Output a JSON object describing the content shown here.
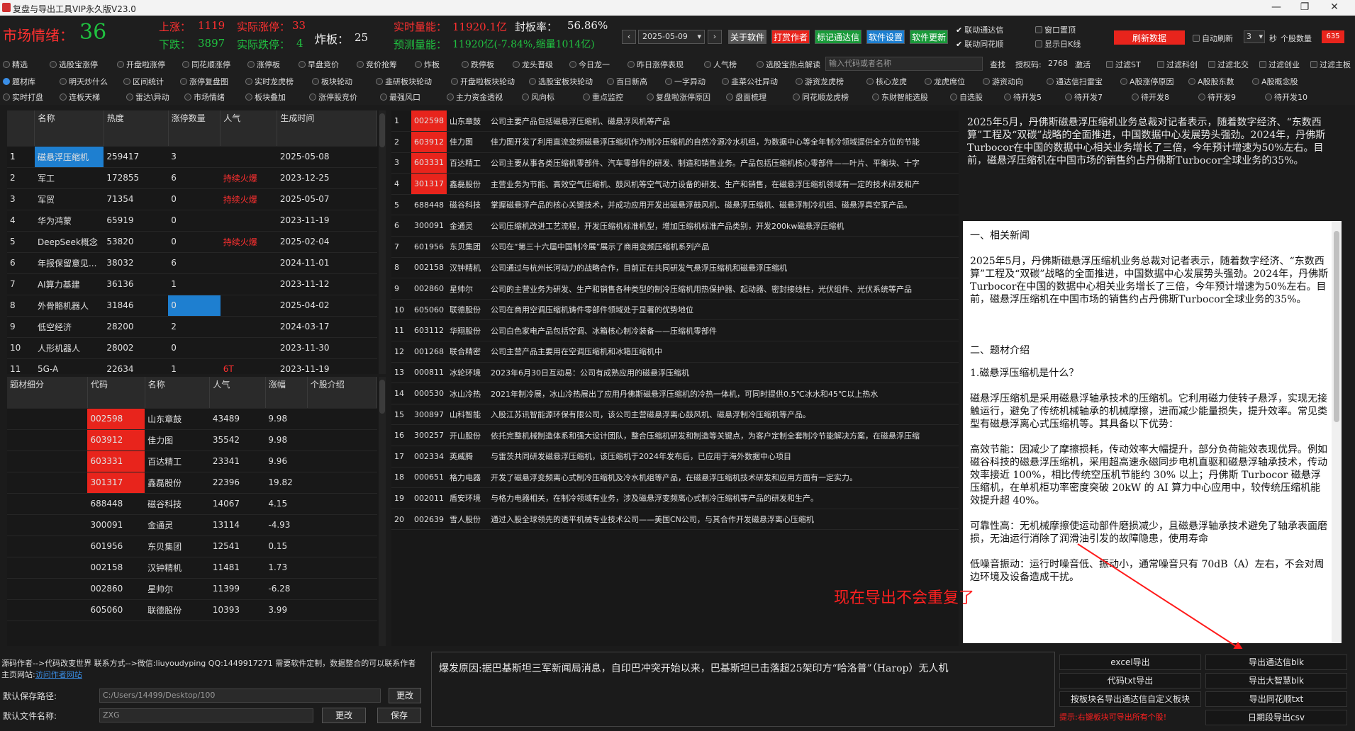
{
  "window": {
    "title": "复盘与导出工具VIP永久版V23.0",
    "min": "—",
    "max": "❐",
    "close": "✕"
  },
  "header": {
    "mood_label": "市场情绪：",
    "mood_value": "36",
    "up_label": "上涨：",
    "up_value": "1119",
    "limit_up_label": "实际涨停：",
    "limit_up_value": "33",
    "down_label": "下跌：",
    "down_value": "3897",
    "limit_down_label": "实际跌停：",
    "limit_down_value": "4",
    "break_label": "炸板：",
    "break_value": "25",
    "volume_label": "实时量能：",
    "volume_value": "11920.1亿",
    "seal_label": "封板率：",
    "seal_value": "56.86%",
    "forecast_label": "预测量能：",
    "forecast_value": "11920亿(-7.84%,缩量1014亿)",
    "date": "2025-05-09"
  },
  "toolbar": {
    "about": "关于软件",
    "reward": "打赏作者",
    "mark": "标记通达信",
    "settings": "软件设置",
    "update": "软件更新",
    "tdx_link": "联动通达信",
    "ths_link": "联动同花顺",
    "win_top": "窗口置顶",
    "show_day": "显示日K线",
    "refresh": "刷新数据",
    "auto_refresh": "自动刷新",
    "auto_sec": "3",
    "sec_unit": "秒",
    "stock_count_label": "个股数量",
    "stock_count": "635"
  },
  "row1": [
    "精选",
    "选股宝涨停",
    "开盘啦涨停",
    "同花顺涨停",
    "涨停板",
    "早盘竞价",
    "竞价抢筹",
    "炸板",
    "跌停板",
    "龙头晋级",
    "今日龙一",
    "昨日涨停表现",
    "人气榜",
    "选股宝热点解读"
  ],
  "search": {
    "placeholder": "输入代码或者名称",
    "btn": "查找",
    "auth_label": "授权码:",
    "auth_code": "2768",
    "activate": "激活"
  },
  "filters": [
    "过滤ST",
    "过滤科创",
    "过滤北交",
    "过滤创业",
    "过滤主板"
  ],
  "row2": [
    "题材库",
    "明天炒什么",
    "区间统计",
    "涨停复盘图",
    "实时龙虎榜",
    "板块轮动",
    "韭研板块轮动",
    "开盘啦板块轮动",
    "选股宝板块轮动",
    "百日新高",
    "一字异动",
    "韭菜公社异动",
    "游资龙虎榜",
    "核心龙虎",
    "龙虎席位",
    "游资动向",
    "通达信扫雷宝",
    "A股涨停原因",
    "A股股东数",
    "A股概念股"
  ],
  "row3": [
    "实时打盘",
    "连板天梯",
    "雷达\\异动",
    "市场情绪",
    "板块叠加",
    "涨停股竞价",
    "最强风口",
    "主力资金透视",
    "风向标",
    "重点监控",
    "复盘啦涨停原因",
    "盘面梳理",
    "同花顺龙虎榜",
    "东财智能选股",
    "自选股",
    "待开发5",
    "待开发7",
    "待开发8",
    "待开发9",
    "待开发10"
  ],
  "theme_table": {
    "headers": [
      "",
      "名称",
      "热度",
      "涨停数量",
      "人气",
      "生成时间"
    ],
    "rows": [
      [
        "1",
        "磁悬浮压缩机",
        "259417",
        "3",
        "",
        "2025-05-08"
      ],
      [
        "2",
        "军工",
        "172855",
        "6",
        "持续火爆",
        "2023-12-25"
      ],
      [
        "3",
        "军贸",
        "71354",
        "0",
        "持续火爆",
        "2025-05-07"
      ],
      [
        "4",
        "华为鸿蒙",
        "65919",
        "0",
        "",
        "2023-11-19"
      ],
      [
        "5",
        "DeepSeek概念",
        "53820",
        "0",
        "持续火爆",
        "2025-02-04"
      ],
      [
        "6",
        "年报保留意见...",
        "38032",
        "6",
        "",
        "2024-11-01"
      ],
      [
        "7",
        "AI算力基建",
        "36136",
        "1",
        "",
        "2023-11-12"
      ],
      [
        "8",
        "外骨骼机器人",
        "31846",
        "0",
        "",
        "2025-04-02"
      ],
      [
        "9",
        "低空经济",
        "28200",
        "2",
        "",
        "2024-03-17"
      ],
      [
        "10",
        "人形机器人",
        "28002",
        "0",
        "",
        "2023-11-30"
      ],
      [
        "11",
        "5G-A",
        "22634",
        "1",
        "6T",
        "2023-11-19"
      ]
    ]
  },
  "stock_table": {
    "headers": [
      "题材细分",
      "代码",
      "名称",
      "人气",
      "涨幅",
      "个股介绍"
    ],
    "rows": [
      [
        "",
        "002598",
        "山东章鼓",
        "43489",
        "9.98",
        ""
      ],
      [
        "",
        "603912",
        "佳力图",
        "35542",
        "9.98",
        ""
      ],
      [
        "",
        "603331",
        "百达精工",
        "23341",
        "9.96",
        ""
      ],
      [
        "",
        "301317",
        "鑫磊股份",
        "22396",
        "19.82",
        ""
      ],
      [
        "",
        "688448",
        "磁谷科技",
        "14067",
        "4.15",
        ""
      ],
      [
        "",
        "300091",
        "金通灵",
        "13114",
        "-4.93",
        ""
      ],
      [
        "",
        "601956",
        "东贝集团",
        "12541",
        "0.15",
        ""
      ],
      [
        "",
        "002158",
        "汉钟精机",
        "11481",
        "1.73",
        ""
      ],
      [
        "",
        "002860",
        "星帅尔",
        "11399",
        "-6.28",
        ""
      ],
      [
        "",
        "605060",
        "联德股份",
        "10393",
        "3.99",
        ""
      ]
    ]
  },
  "intro_table": {
    "rows": [
      [
        "1",
        "002598",
        "山东章鼓",
        "公司主要产品包括磁悬浮压缩机、磁悬浮风机等产品"
      ],
      [
        "2",
        "603912",
        "佳力图",
        "佳力图开发了利用直流变频磁悬浮压缩机作为制冷压缩机的自然冷源冷水机组，为数据中心等全年制冷领域提供全方位的节能"
      ],
      [
        "3",
        "603331",
        "百达精工",
        "公司主要从事各类压缩机零部件、汽车零部件的研发、制造和销售业务。产品包括压缩机核心零部件——叶片、平衡块、十字"
      ],
      [
        "4",
        "301317",
        "鑫磊股份",
        "主营业务为节能、高效空气压缩机、鼓风机等空气动力设备的研发、生产和销售，在磁悬浮压缩机领域有一定的技术研发和产"
      ],
      [
        "5",
        "688448",
        "磁谷科技",
        "掌握磁悬浮产品的核心关键技术，并成功应用开发出磁悬浮鼓风机、磁悬浮压缩机、磁悬浮制冷机组、磁悬浮真空泵产品。"
      ],
      [
        "6",
        "300091",
        "金通灵",
        "公司压缩机改进工艺流程，开发压缩机标准机型，增加压缩机标准产品类别，开发200kw磁悬浮压缩机"
      ],
      [
        "7",
        "601956",
        "东贝集团",
        "公司在“第三十六届中国制冷展”展示了商用变频压缩机系列产品"
      ],
      [
        "8",
        "002158",
        "汉钟精机",
        "公司通过与杭州长河动力的战略合作，目前正在共同研发气悬浮压缩机和磁悬浮压缩机"
      ],
      [
        "9",
        "002860",
        "星帅尔",
        "公司的主营业务为研发、生产和销售各种类型的制冷压缩机用热保护器、起动器、密封接线柱，光伏组件、光伏系统等产品"
      ],
      [
        "10",
        "605060",
        "联德股份",
        "公司在商用空调压缩机铸件零部件领域处于显著的优势地位"
      ],
      [
        "11",
        "603112",
        "华翔股份",
        "公司白色家电产品包括空调、冰箱核心制冷装备——压缩机零部件"
      ],
      [
        "12",
        "001268",
        "联合精密",
        "公司主营产品主要用在空调压缩机和冰箱压缩机中"
      ],
      [
        "13",
        "000811",
        "冰轮环境",
        "2023年6月30日互动易：公司有成熟应用的磁悬浮压缩机"
      ],
      [
        "14",
        "000530",
        "冰山冷热",
        "2021年制冷展，冰山冷热展出了应用丹佛斯磁悬浮压缩机的冷热一体机，可同时提供0.5℃冰水和45℃以上热水"
      ],
      [
        "15",
        "300897",
        "山科智能",
        "入股江苏讯智能源环保有限公司，该公司主营磁悬浮离心鼓风机、磁悬浮制冷压缩机等产品。"
      ],
      [
        "16",
        "300257",
        "开山股份",
        "依托完整机械制造体系和强大设计团队，整合压缩机研发和制造等关键点，为客户定制全套制冷节能解决方案，在磁悬浮压缩"
      ],
      [
        "17",
        "002334",
        "英威腾",
        "与雷茨共同研发磁悬浮压缩机，该压缩机于2024年发布后，已应用于海外数据中心项目"
      ],
      [
        "18",
        "000651",
        "格力电器",
        "开发了磁悬浮变频离心式制冷压缩机及冷水机组等产品，在磁悬浮压缩机技术研发和应用方面有一定实力。"
      ],
      [
        "19",
        "002011",
        "盾安环境",
        "与格力电器相关，在制冷领域有业务，涉及磁悬浮变频离心式制冷压缩机等产品的研发和生产。"
      ],
      [
        "20",
        "002639",
        "雪人股份",
        "通过入股全球领先的透平机械专业技术公司——美国CN公司，与其合作开发磁悬浮离心压缩机"
      ]
    ]
  },
  "summary": "2025年5月，丹佛斯磁悬浮压缩机业务总裁对记者表示，随着数字经济、“东数西算”工程及“双碳”战略的全面推进，中国数据中心发展势头强劲。2024年，丹佛斯Turbocor在中国的数据中心相关业务增长了三倍，今年预计增速为50%左右。目前，磁悬浮压缩机在中国市场的销售约占丹佛斯Turbocor全球业务的35%。",
  "article": {
    "h1": "一、相关新闻",
    "p1": "2025年5月，丹佛斯磁悬浮压缩机业务总裁对记者表示，随着数字经济、“东数西算”工程及“双碳”战略的全面推进，中国数据中心发展势头强劲。2024年，丹佛斯Turbocor在中国的数据中心相关业务增长了三倍，今年预计增速为50%左右。目前，磁悬浮压缩机在中国市场的销售约占丹佛斯Turbocor全球业务的35%。",
    "h2": "二、题材介绍",
    "q1": "1.磁悬浮压缩机是什么？",
    "p2": "磁悬浮压缩机是采用磁悬浮轴承技术的压缩机。它利用磁力使转子悬浮，实现无接触运行，避免了传统机械轴承的机械摩擦，进而减少能量损失，提升效率。常见类型有磁悬浮离心式压缩机等。其具备以下优势：",
    "p3": "高效节能：因减少了摩擦损耗，传动效率大幅提升，部分负荷能效表现优异。例如磁谷科技的磁悬浮压缩机，采用超高速永磁同步电机直驱和磁悬浮轴承技术，传动效率接近 100%，相比传统空压机节能约 30% 以上；丹佛斯 Turbocor 磁悬浮压缩机，在单机柜功率密度突破 20kW 的 AI 算力中心应用中，较传统压缩机能效提升超 40%。",
    "p4": "可靠性高：无机械摩擦使运动部件磨损减少，且磁悬浮轴承技术避免了轴承表面磨损，无油运行消除了润滑油引发的故障隐患，使用寿命",
    "p5": "低噪音振动：运行时噪音低、振动小，通常噪音只有 70dB（A）左右，不会对周边环境及设备造成干扰。"
  },
  "annotation": "现在导出不会重复了",
  "bottom": {
    "author_line": "源码作者-->代码改变世界 联系方式-->微信:liuyoudyping QQ:1449917271 需要软件定制，数据整合的可以联系作者",
    "homepage_label": "主页网站:",
    "homepage_link": "访问作者网站",
    "save_path_label": "默认保存路径:",
    "save_path": "C:/Users/14499/Desktop/100",
    "change1": "更改",
    "file_name_label": "默认文件名称:",
    "file_name": "ZXG",
    "change2": "更改",
    "save": "保存",
    "reason": "爆发原因:据巴基斯坦三军新闻局消息，自印巴冲突开始以来，巴基斯坦已击落超25架印方“哈洛普”（Harop）无人机",
    "tip": "提示:右键板块可导出所有个股!"
  },
  "exports": [
    "excel导出",
    "导出通达信blk",
    "代码txt导出",
    "导出大智慧blk",
    "按板块名导出通达信自定义板块",
    "导出同花顺txt",
    "",
    "日期段导出csv"
  ]
}
